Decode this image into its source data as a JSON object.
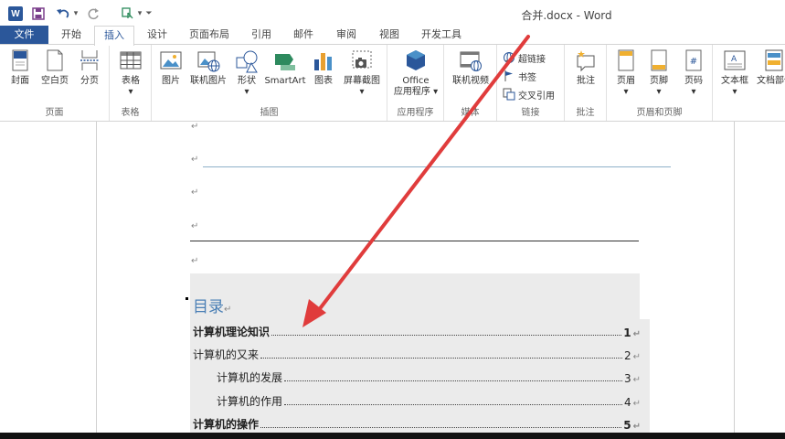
{
  "titlebar": {
    "logo": "W",
    "title": "合并.docx - Word",
    "qat": [
      "save-icon",
      "undo-icon",
      "redo-icon",
      "touch-mode-icon",
      "customize-icon"
    ]
  },
  "tabs": [
    {
      "label": "文件"
    },
    {
      "label": "开始"
    },
    {
      "label": "插入"
    },
    {
      "label": "设计"
    },
    {
      "label": "页面布局"
    },
    {
      "label": "引用"
    },
    {
      "label": "邮件"
    },
    {
      "label": "审阅"
    },
    {
      "label": "视图"
    },
    {
      "label": "开发工具"
    }
  ],
  "active_tab": "插入",
  "ribbon": {
    "groups": {
      "pages": {
        "label": "页面",
        "buttons": [
          "封面",
          "空白页",
          "分页"
        ]
      },
      "tables": {
        "label": "表格",
        "buttons": [
          "表格"
        ]
      },
      "illustrations": {
        "label": "插图",
        "buttons": [
          "图片",
          "联机图片",
          "形状",
          "SmartArt",
          "图表",
          "屏幕截图"
        ]
      },
      "apps": {
        "label": "应用程序",
        "line1": "Office",
        "line2": "应用程序"
      },
      "media": {
        "label": "媒体",
        "buttons": [
          "联机视频"
        ]
      },
      "links": {
        "label": "链接",
        "buttons": [
          "超链接",
          "书签",
          "交叉引用"
        ]
      },
      "comments": {
        "label": "批注",
        "buttons": [
          "批注"
        ]
      },
      "header_footer": {
        "label": "页眉和页脚",
        "buttons": [
          "页眉",
          "页脚",
          "页码"
        ]
      },
      "text": {
        "buttons": [
          "文本框",
          "文档部件"
        ]
      }
    }
  },
  "document": {
    "para_mark": "↵",
    "toc_title": "目录",
    "toc": [
      {
        "text": "计算机理论知识",
        "page": "1",
        "level": 1
      },
      {
        "text": "计算机的又来",
        "page": "2",
        "level": 1
      },
      {
        "text": "计算机的发展",
        "page": "3",
        "level": 2
      },
      {
        "text": "计算机的作用",
        "page": "4",
        "level": 2
      },
      {
        "text": "计算机的操作",
        "page": "5",
        "level": 1
      }
    ]
  },
  "colors": {
    "accent": "#2b579a",
    "toc_title": "#4a7fb5",
    "arrow": "#e03c3c"
  }
}
